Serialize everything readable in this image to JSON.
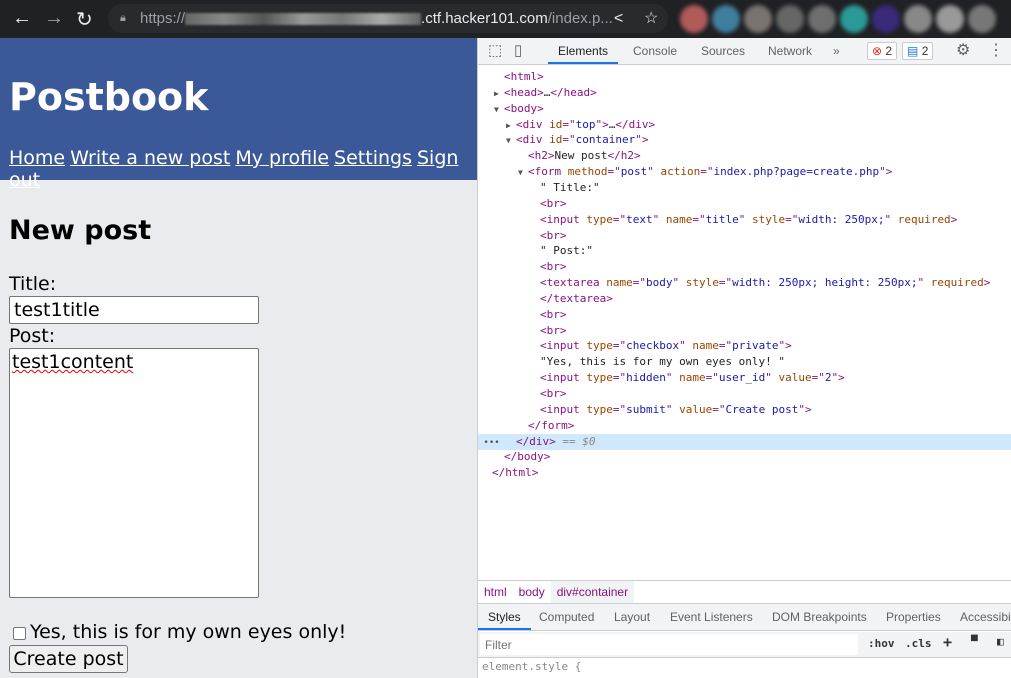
{
  "browser": {
    "url_prefix": "https://",
    "url_host": ".ctf.hacker101.com",
    "url_path": "/index.p...",
    "icons": [
      "back-icon",
      "forward-icon",
      "reload-icon",
      "lock-icon",
      "share-icon",
      "bookmark-star-icon"
    ]
  },
  "page": {
    "site_title": "Postbook",
    "nav": [
      "Home",
      "Write a new post",
      "My profile",
      "Settings",
      "Sign out"
    ],
    "heading": "New post",
    "title_label": "Title:",
    "title_value": "test1title",
    "post_label": "Post:",
    "post_value": "test1content",
    "private_label": "Yes, this is for my own eyes only!",
    "private_checked": false,
    "submit_label": "Create post",
    "colors": {
      "header": "#3b5998",
      "background": "#e9ebee"
    }
  },
  "devtools": {
    "tabs": [
      "Elements",
      "Console",
      "Sources",
      "Network",
      "»"
    ],
    "active_tab": "Elements",
    "errors": "2",
    "messages": "2",
    "tree": [
      {
        "depth": 0,
        "arrow": "",
        "parts": [
          [
            "tag",
            "<html>"
          ]
        ]
      },
      {
        "depth": 0,
        "arrow": "▶",
        "parts": [
          [
            "tag",
            "<head>"
          ],
          [
            "tx",
            "…"
          ],
          [
            "tag",
            "</head>"
          ]
        ]
      },
      {
        "depth": 0,
        "arrow": "▼",
        "parts": [
          [
            "tag",
            "<body>"
          ]
        ]
      },
      {
        "depth": 1,
        "arrow": "▶",
        "parts": [
          [
            "tag",
            "<div "
          ],
          [
            "an",
            "id"
          ],
          [
            "tag",
            "=\""
          ],
          [
            "av",
            "top"
          ],
          [
            "tag",
            "\">"
          ],
          [
            "tx",
            "…"
          ],
          [
            "tag",
            "</div>"
          ]
        ]
      },
      {
        "depth": 1,
        "arrow": "▼",
        "parts": [
          [
            "tag",
            "<div "
          ],
          [
            "an",
            "id"
          ],
          [
            "tag",
            "=\""
          ],
          [
            "av",
            "container"
          ],
          [
            "tag",
            "\">"
          ]
        ]
      },
      {
        "depth": 2,
        "arrow": "",
        "parts": [
          [
            "tag",
            "<h2>"
          ],
          [
            "tx",
            "New post"
          ],
          [
            "tag",
            "</h2>"
          ]
        ]
      },
      {
        "depth": 2,
        "arrow": "▼",
        "parts": [
          [
            "tag",
            "<form "
          ],
          [
            "an",
            "method"
          ],
          [
            "tag",
            "=\""
          ],
          [
            "av",
            "post"
          ],
          [
            "tag",
            "\" "
          ],
          [
            "an",
            "action"
          ],
          [
            "tag",
            "=\""
          ],
          [
            "av",
            "index.php?page=create.php"
          ],
          [
            "tag",
            "\">"
          ]
        ]
      },
      {
        "depth": 3,
        "arrow": "",
        "parts": [
          [
            "tx",
            "\" Title:\""
          ]
        ]
      },
      {
        "depth": 3,
        "arrow": "",
        "parts": [
          [
            "tag",
            "<br>"
          ]
        ]
      },
      {
        "depth": 3,
        "arrow": "",
        "parts": [
          [
            "tag",
            "<input "
          ],
          [
            "an",
            "type"
          ],
          [
            "tag",
            "=\""
          ],
          [
            "av",
            "text"
          ],
          [
            "tag",
            "\" "
          ],
          [
            "an",
            "name"
          ],
          [
            "tag",
            "=\""
          ],
          [
            "av",
            "title"
          ],
          [
            "tag",
            "\" "
          ],
          [
            "an",
            "style"
          ],
          [
            "tag",
            "=\""
          ],
          [
            "av",
            "width: 250px;"
          ],
          [
            "tag",
            "\" "
          ],
          [
            "an",
            "required"
          ],
          [
            "tag",
            ">"
          ]
        ]
      },
      {
        "depth": 3,
        "arrow": "",
        "parts": [
          [
            "tag",
            "<br>"
          ]
        ]
      },
      {
        "depth": 3,
        "arrow": "",
        "parts": [
          [
            "tx",
            "\" Post:\""
          ]
        ]
      },
      {
        "depth": 3,
        "arrow": "",
        "parts": [
          [
            "tag",
            "<br>"
          ]
        ]
      },
      {
        "depth": 3,
        "arrow": "",
        "parts": [
          [
            "tag",
            "<textarea "
          ],
          [
            "an",
            "name"
          ],
          [
            "tag",
            "=\""
          ],
          [
            "av",
            "body"
          ],
          [
            "tag",
            "\" "
          ],
          [
            "an",
            "style"
          ],
          [
            "tag",
            "=\""
          ],
          [
            "av",
            "width: 250px; height: 250px;"
          ],
          [
            "tag",
            "\" "
          ],
          [
            "an",
            "required"
          ],
          [
            "tag",
            ">"
          ]
        ]
      },
      {
        "depth": 3,
        "arrow": "",
        "parts": [
          [
            "tag",
            "</textarea>"
          ]
        ]
      },
      {
        "depth": 3,
        "arrow": "",
        "parts": [
          [
            "tag",
            "<br>"
          ]
        ]
      },
      {
        "depth": 3,
        "arrow": "",
        "parts": [
          [
            "tag",
            "<br>"
          ]
        ]
      },
      {
        "depth": 3,
        "arrow": "",
        "parts": [
          [
            "tag",
            "<input "
          ],
          [
            "an",
            "type"
          ],
          [
            "tag",
            "=\""
          ],
          [
            "av",
            "checkbox"
          ],
          [
            "tag",
            "\" "
          ],
          [
            "an",
            "name"
          ],
          [
            "tag",
            "=\""
          ],
          [
            "av",
            "private"
          ],
          [
            "tag",
            "\">"
          ]
        ]
      },
      {
        "depth": 3,
        "arrow": "",
        "parts": [
          [
            "tx",
            "\"Yes, this is for my own eyes only! \""
          ]
        ]
      },
      {
        "depth": 3,
        "arrow": "",
        "parts": [
          [
            "tag",
            "<input "
          ],
          [
            "an",
            "type"
          ],
          [
            "tag",
            "=\""
          ],
          [
            "av",
            "hidden"
          ],
          [
            "tag",
            "\" "
          ],
          [
            "an",
            "name"
          ],
          [
            "tag",
            "=\""
          ],
          [
            "av",
            "user_id"
          ],
          [
            "tag",
            "\" "
          ],
          [
            "an",
            "value"
          ],
          [
            "tag",
            "=\""
          ],
          [
            "av",
            "2"
          ],
          [
            "tag",
            "\">"
          ]
        ]
      },
      {
        "depth": 3,
        "arrow": "",
        "parts": [
          [
            "tag",
            "<br>"
          ]
        ]
      },
      {
        "depth": 3,
        "arrow": "",
        "parts": [
          [
            "tag",
            "<input "
          ],
          [
            "an",
            "type"
          ],
          [
            "tag",
            "=\""
          ],
          [
            "av",
            "submit"
          ],
          [
            "tag",
            "\" "
          ],
          [
            "an",
            "value"
          ],
          [
            "tag",
            "=\""
          ],
          [
            "av",
            "Create post"
          ],
          [
            "tag",
            "\">"
          ]
        ]
      },
      {
        "depth": 2,
        "arrow": "",
        "parts": [
          [
            "tag",
            "</form>"
          ]
        ]
      },
      {
        "depth": 1,
        "arrow": "",
        "selected": true,
        "parts": [
          [
            "tag",
            "</div>"
          ],
          [
            "dim",
            " == $0"
          ]
        ]
      },
      {
        "depth": 0,
        "arrow": "",
        "parts": [
          [
            "tag",
            "</body>"
          ]
        ]
      },
      {
        "depth": -1,
        "arrow": "",
        "parts": [
          [
            "tag",
            "</html>"
          ]
        ]
      }
    ],
    "breadcrumbs": [
      "html",
      "body",
      "div#container"
    ],
    "style_tabs": [
      "Styles",
      "Computed",
      "Layout",
      "Event Listeners",
      "DOM Breakpoints",
      "Properties",
      "Accessibi"
    ],
    "active_style_tab": "Styles",
    "filter_placeholder": "Filter",
    "hov": ":hov",
    "cls": ".cls",
    "element_style": "element.style {"
  }
}
